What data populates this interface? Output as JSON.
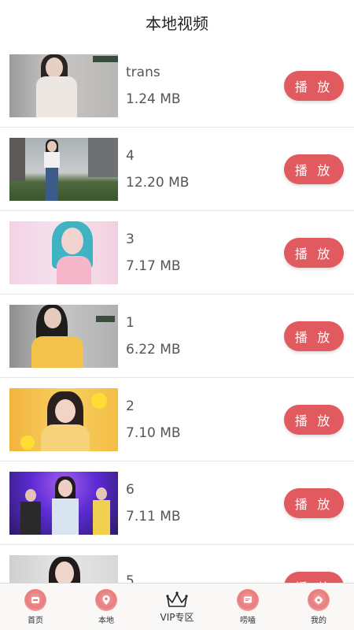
{
  "header": {
    "title": "本地视频"
  },
  "play_label": "播 放",
  "videos": [
    {
      "name": "trans",
      "size": "1.24 MB"
    },
    {
      "name": "4",
      "size": "12.20 MB"
    },
    {
      "name": "3",
      "size": "7.17 MB"
    },
    {
      "name": "1",
      "size": "6.22 MB"
    },
    {
      "name": "2",
      "size": "7.10 MB"
    },
    {
      "name": "6",
      "size": "7.11 MB"
    },
    {
      "name": "5",
      "size": ""
    }
  ],
  "tabbar": {
    "items": [
      {
        "label": "首页",
        "icon": "home-icon"
      },
      {
        "label": "本地",
        "icon": "location-pin-icon"
      },
      {
        "label": "VIP专区",
        "icon": "crown-icon"
      },
      {
        "label": "唠嗑",
        "icon": "chat-icon"
      },
      {
        "label": "我的",
        "icon": "settings-icon"
      }
    ]
  },
  "colors": {
    "accent": "#e05a5f",
    "tab_icon": "#e97c7c"
  }
}
